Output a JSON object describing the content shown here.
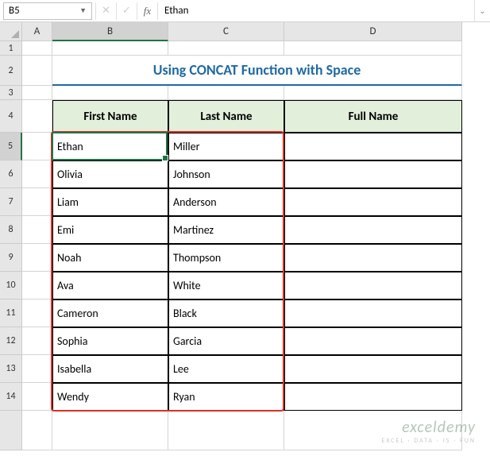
{
  "name_box": "B5",
  "formula_value": "Ethan",
  "columns": [
    "A",
    "B",
    "C",
    "D"
  ],
  "rows": [
    "1",
    "2",
    "3",
    "4",
    "5",
    "6",
    "7",
    "8",
    "9",
    "10",
    "11",
    "12",
    "13",
    "14"
  ],
  "title": "Using CONCAT Function with Space",
  "headers": {
    "first": "First Name",
    "last": "Last Name",
    "full": "Full Name"
  },
  "data": [
    {
      "first": "Ethan",
      "last": "Miller",
      "full": ""
    },
    {
      "first": "Olivia",
      "last": "Johnson",
      "full": ""
    },
    {
      "first": "Liam",
      "last": "Anderson",
      "full": ""
    },
    {
      "first": "Emi",
      "last": "Martinez",
      "full": ""
    },
    {
      "first": "Noah",
      "last": "Thompson",
      "full": ""
    },
    {
      "first": "Ava",
      "last": "White",
      "full": ""
    },
    {
      "first": "Cameron",
      "last": "Black",
      "full": ""
    },
    {
      "first": "Sophia",
      "last": "Garcia",
      "full": ""
    },
    {
      "first": "Isabella",
      "last": "Lee",
      "full": ""
    },
    {
      "first": "Wendy",
      "last": "Ryan",
      "full": ""
    }
  ],
  "watermark": {
    "main": "exceldemy",
    "sub": "EXCEL · DATA · IS · FUN"
  }
}
